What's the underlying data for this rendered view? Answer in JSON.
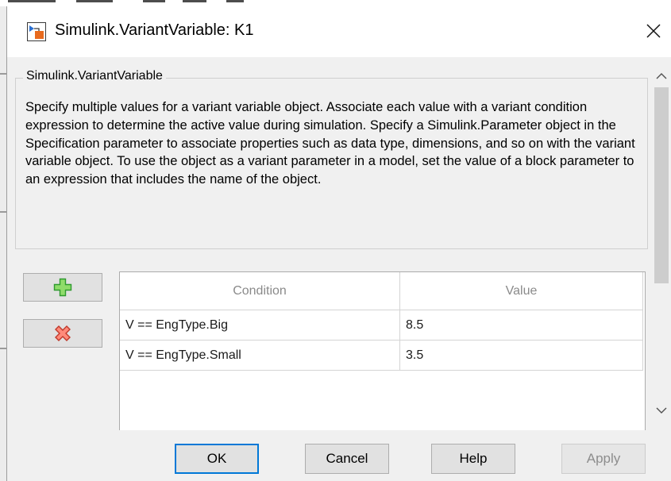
{
  "window": {
    "title": "Simulink.VariantVariable: K1",
    "app_icon": "simulink-model-icon",
    "close_icon": "close-icon"
  },
  "group": {
    "legend": "Simulink.VariantVariable",
    "description": "Specify multiple values for a variant variable object. Associate each value with a variant condition expression to determine the active value during simulation. Specify a Simulink.Parameter object in the Specification parameter to associate properties such as data type, dimensions, and so on with the variant variable object. To use the object as a variant parameter in a model, set the value of a block parameter to an expression that includes the name of the object."
  },
  "table": {
    "add_icon": "plus-icon",
    "delete_icon": "delete-x-icon",
    "columns": [
      "Condition",
      "Value"
    ],
    "rows": [
      {
        "condition": "V == EngType.Big",
        "value": "8.5"
      },
      {
        "condition": "V == EngType.Small",
        "value": "3.5"
      }
    ]
  },
  "buttons": {
    "ok": "OK",
    "cancel": "Cancel",
    "help": "Help",
    "apply": "Apply"
  },
  "colors": {
    "dialog_bg": "#f0f0f0",
    "default_button_border": "#0078d7",
    "add_icon_green": "#3cb43c",
    "delete_icon_red": "#e03c3c",
    "disabled_text": "#8d8d8d"
  }
}
